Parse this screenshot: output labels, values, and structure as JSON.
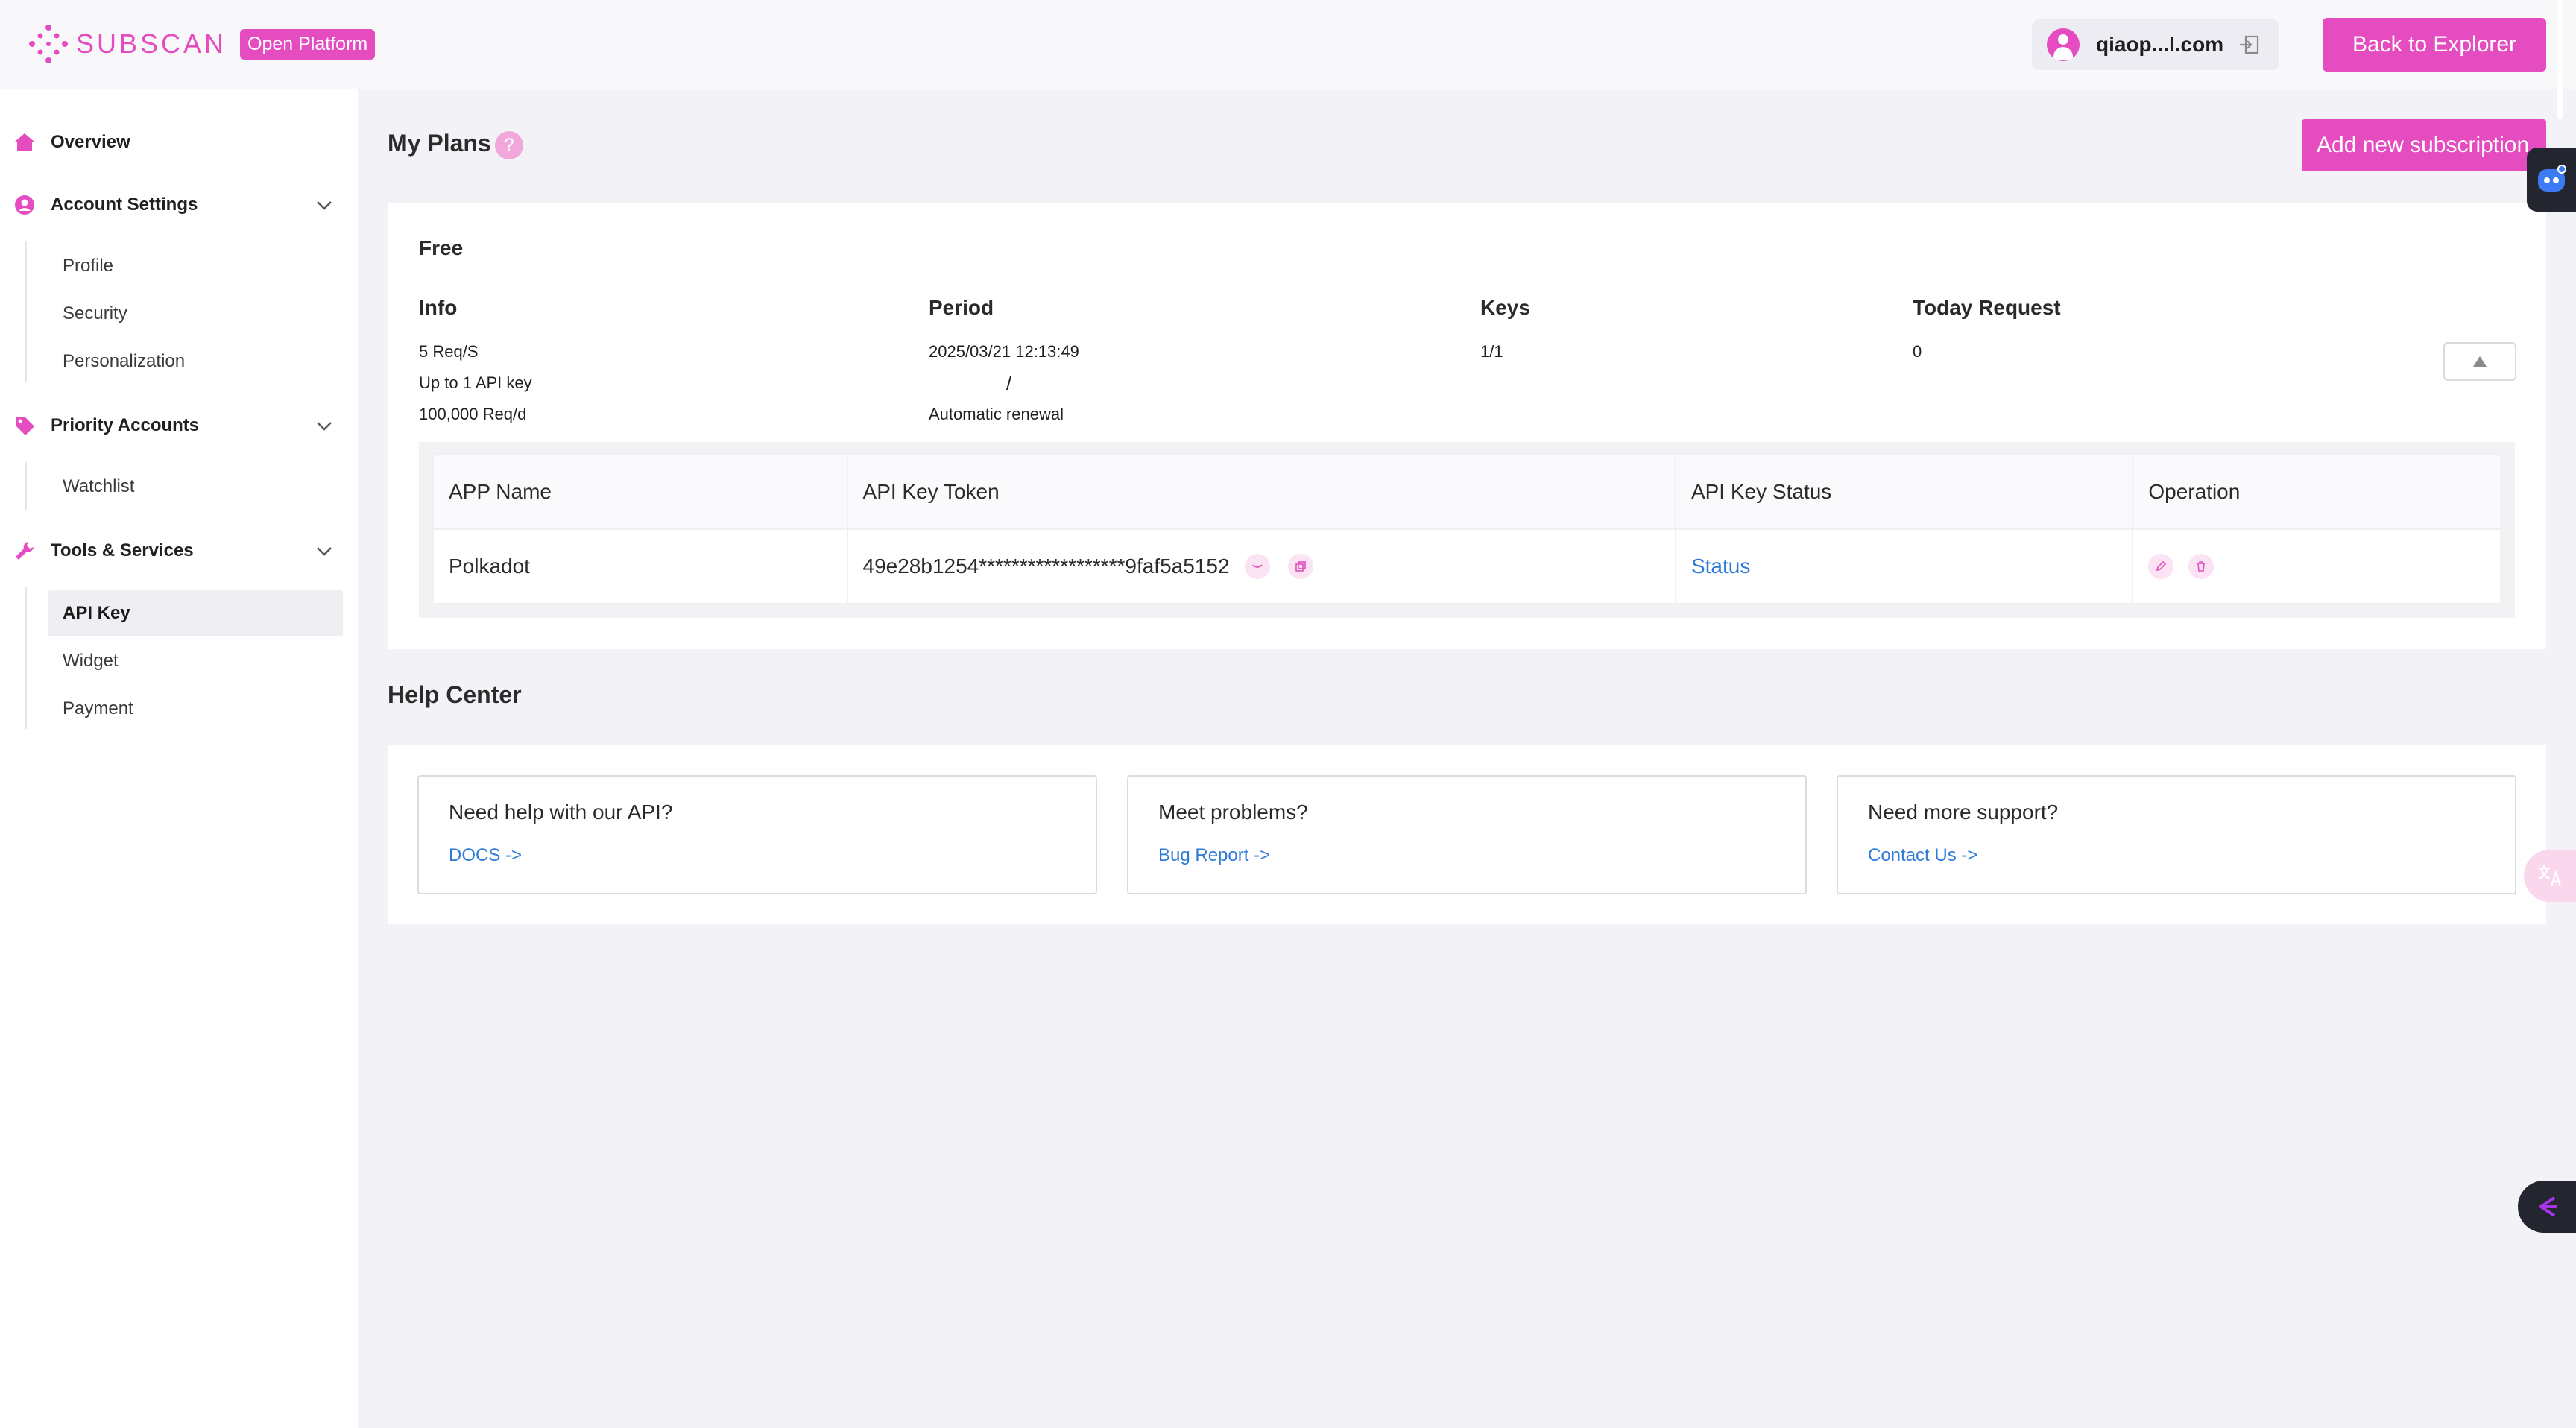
{
  "header": {
    "logo_text": "SUBSCAN",
    "platform_badge": "Open Platform",
    "user_email": "qiaop...l.com",
    "back_button": "Back to Explorer"
  },
  "sidebar": {
    "overview": "Overview",
    "account_settings": {
      "label": "Account Settings",
      "items": [
        "Profile",
        "Security",
        "Personalization"
      ]
    },
    "priority_accounts": {
      "label": "Priority Accounts",
      "items": [
        "Watchlist"
      ]
    },
    "tools_services": {
      "label": "Tools & Services",
      "items": [
        "API Key",
        "Widget",
        "Payment"
      ],
      "active": "API Key"
    }
  },
  "plans": {
    "title": "My Plans",
    "help_badge": "?",
    "add_button": "Add new subscription",
    "plan_name": "Free",
    "columns": [
      "Info",
      "Period",
      "Keys",
      "Today Request"
    ],
    "info_lines": [
      "5 Req/S",
      "Up to 1 API key",
      "100,000 Req/d"
    ],
    "period_lines": [
      "2025/03/21 12:13:49",
      "/",
      "Automatic renewal"
    ],
    "keys": "1/1",
    "today_request": "0",
    "key_table": {
      "headers": [
        "APP Name",
        "API Key Token",
        "API Key Status",
        "Operation"
      ],
      "rows": [
        {
          "app_name": "Polkadot",
          "token": "49e28b1254******************9faf5a5152",
          "status": "Status"
        }
      ]
    }
  },
  "help_center": {
    "title": "Help Center",
    "cards": [
      {
        "title": "Need help with our API?",
        "link": "DOCS ->"
      },
      {
        "title": "Meet problems?",
        "link": "Bug Report ->"
      },
      {
        "title": "Need more support?",
        "link": "Contact Us ->"
      }
    ]
  },
  "colors": {
    "accent": "#e44cbf",
    "link": "#2f7ad8",
    "background": "#f3f3f7"
  },
  "icons": [
    "subscan-logo-icon",
    "user-avatar-icon",
    "logout-icon",
    "home-icon",
    "account-icon",
    "tag-icon",
    "wrench-icon",
    "chevron-down-icon",
    "expand-icon",
    "copy-icon",
    "edit-icon",
    "delete-icon",
    "robot-icon",
    "translate-icon",
    "arrow-left-icon"
  ]
}
